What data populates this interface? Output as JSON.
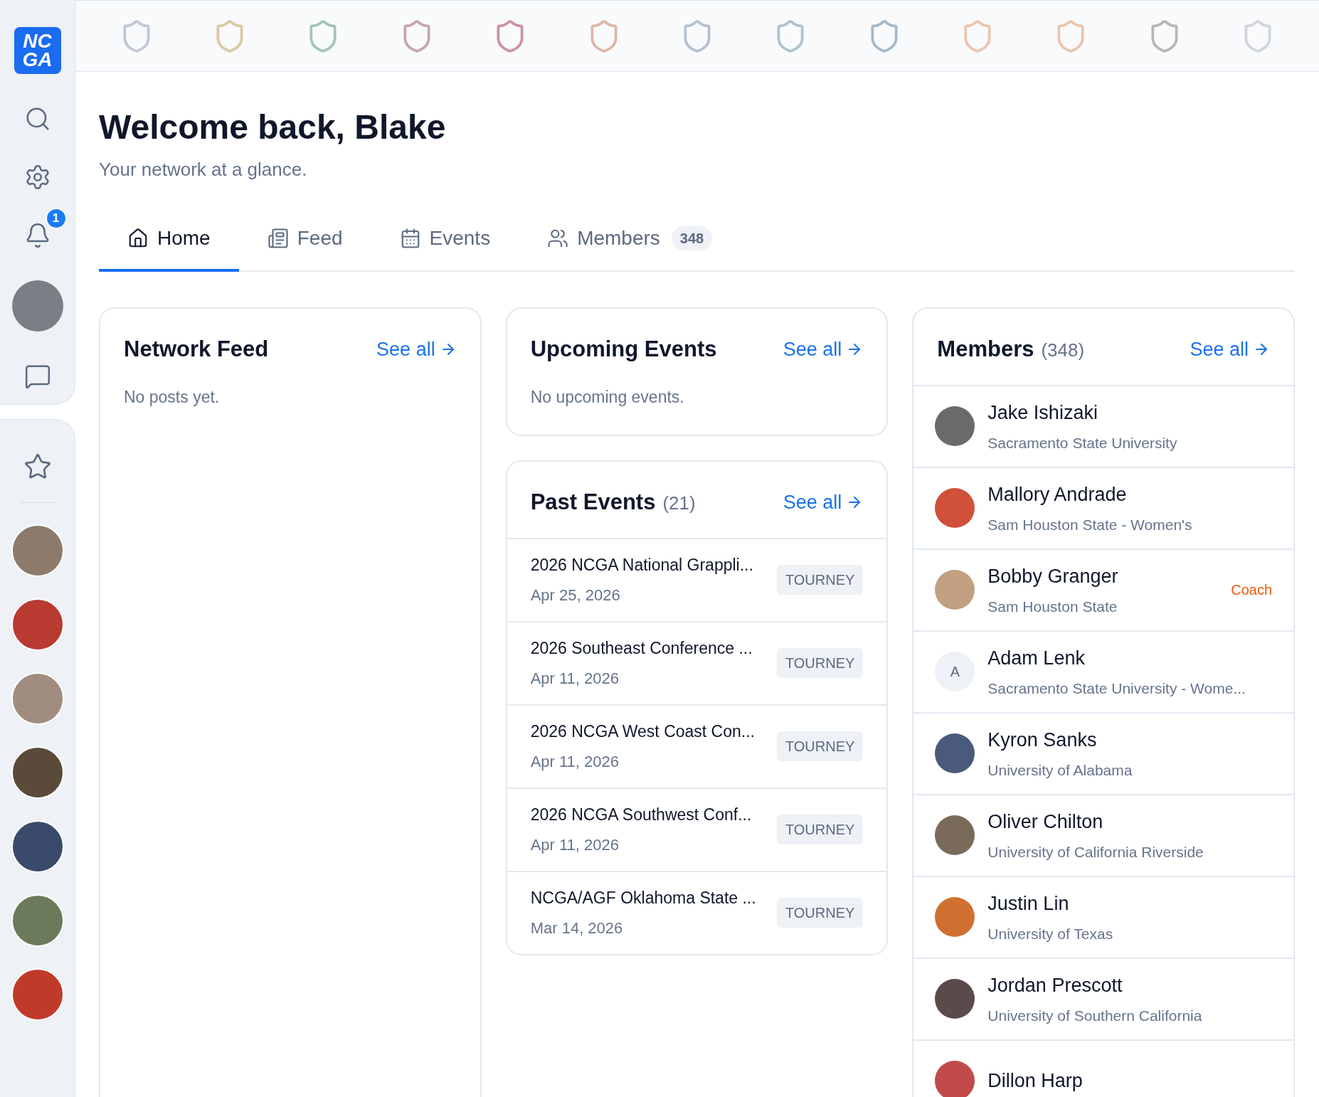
{
  "sidebar": {
    "logo": {
      "line_1": "NC",
      "line_2": "GA"
    },
    "notification_count": "1"
  },
  "header": {
    "title": "Welcome back, Blake",
    "subtitle": "Your network at a glance."
  },
  "tabs": [
    {
      "label": "Home",
      "selected": true
    },
    {
      "label": "Feed",
      "selected": false
    },
    {
      "label": "Events",
      "selected": false
    },
    {
      "label": "Members",
      "selected": false,
      "count": "348"
    }
  ],
  "network_feed": {
    "title": "Network Feed",
    "link": "See all",
    "empty": "No posts yet."
  },
  "upcoming_events": {
    "title": "Upcoming Events",
    "link": "See all",
    "empty": "No upcoming events."
  },
  "past_events": {
    "title": "Past Events",
    "count": "(21)",
    "link": "See all",
    "items": [
      {
        "name": "2026 NCGA National Grappli...",
        "badge": "TOURNEY",
        "date": "Apr 25, 2026"
      },
      {
        "name": "2026 Southeast Conference ...",
        "badge": "TOURNEY",
        "date": "Apr 11, 2026"
      },
      {
        "name": "2026 NCGA West Coast Con...",
        "badge": "TOURNEY",
        "date": "Apr 11, 2026"
      },
      {
        "name": "2026 NCGA Southwest Conf...",
        "badge": "TOURNEY",
        "date": "Apr 11, 2026"
      },
      {
        "name": "NCGA/AGF Oklahoma State ...",
        "badge": "TOURNEY",
        "date": "Mar 14, 2026"
      }
    ]
  },
  "members": {
    "title": "Members",
    "count": "(348)",
    "link": "See all",
    "items": [
      {
        "name": "Jake Ishizaki",
        "school": "Sacramento State University"
      },
      {
        "name": "Mallory Andrade",
        "school": "Sam Houston State - Women's"
      },
      {
        "name": "Bobby Granger",
        "school": "Sam Houston State",
        "role": "Coach"
      },
      {
        "name": "Adam Lenk",
        "school": "Sacramento State University - Wome...",
        "initial": "A"
      },
      {
        "name": "Kyron Sanks",
        "school": "University of Alabama"
      },
      {
        "name": "Oliver Chilton",
        "school": "University of California Riverside"
      },
      {
        "name": "Justin Lin",
        "school": "University of Texas"
      },
      {
        "name": "Jordan Prescott",
        "school": "University of Southern California"
      },
      {
        "name": "Dillon Harp"
      }
    ]
  }
}
